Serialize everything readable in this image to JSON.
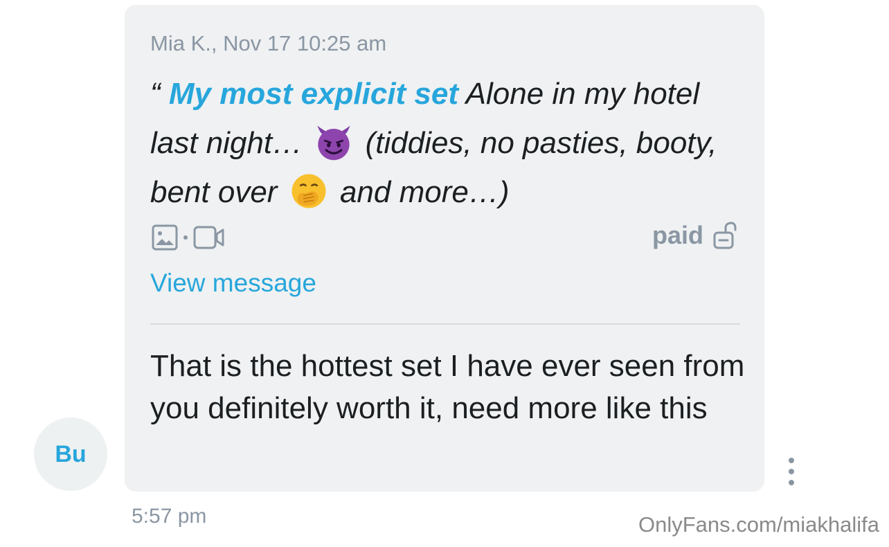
{
  "sender": {
    "avatar_initials": "Bu"
  },
  "quoted_message": {
    "meta": "Mia K., Nov 17 10:25 am",
    "quote_mark": "“",
    "highlight": "My most explicit set",
    "text_part1": "Alone in my hotel last night…",
    "emoji1": "smiling-face-with-horns",
    "text_part2": "(tiddies, no pasties, booty, bent over",
    "emoji2": "face-with-hand-over-mouth",
    "text_part3": "and more…)",
    "media_icons": [
      "image-icon",
      "video-icon"
    ],
    "price_status": "paid",
    "lock_icon": "unlocked-icon",
    "view_link": "View message"
  },
  "reply": {
    "text": "That is the hottest set I have ever seen from you definitely worth it, need more like this"
  },
  "timestamp": "5:57 pm",
  "watermark": "OnlyFans.com/miakhalifa",
  "colors": {
    "accent": "#27a6dc",
    "bubble_bg": "#eff1f2",
    "muted": "#8a96a3"
  }
}
